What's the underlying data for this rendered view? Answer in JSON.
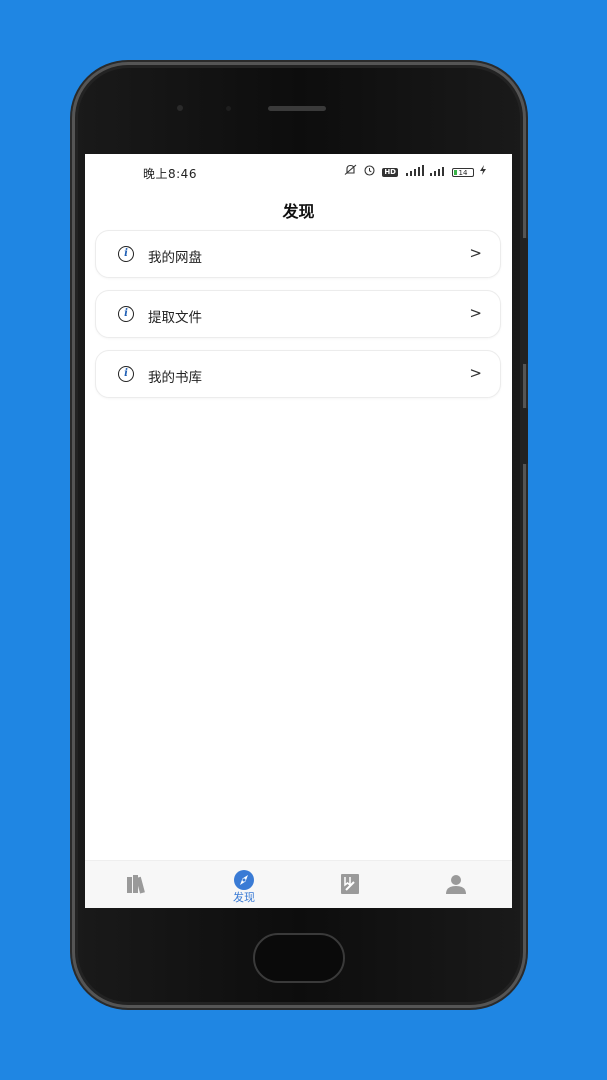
{
  "status_bar": {
    "time": "晚上8:46",
    "battery": "14",
    "hd_badge": "HD"
  },
  "header": {
    "title": "发现"
  },
  "menu": {
    "items": [
      {
        "label": "我的网盘",
        "icon": "info-icon",
        "chevron": ">"
      },
      {
        "label": "提取文件",
        "icon": "info-icon",
        "chevron": ">"
      },
      {
        "label": "我的书库",
        "icon": "info-icon",
        "chevron": ">"
      }
    ]
  },
  "tabbar": {
    "active_label": "发现",
    "tabs": [
      {
        "icon": "bookshelf-icon"
      },
      {
        "icon": "compass-icon",
        "label": "发现"
      },
      {
        "icon": "bookmark-icon"
      },
      {
        "icon": "user-icon"
      }
    ]
  },
  "colors": {
    "background": "#1f86e3",
    "accent": "#3a7bd5",
    "tab_inactive": "#9a9a9a"
  }
}
